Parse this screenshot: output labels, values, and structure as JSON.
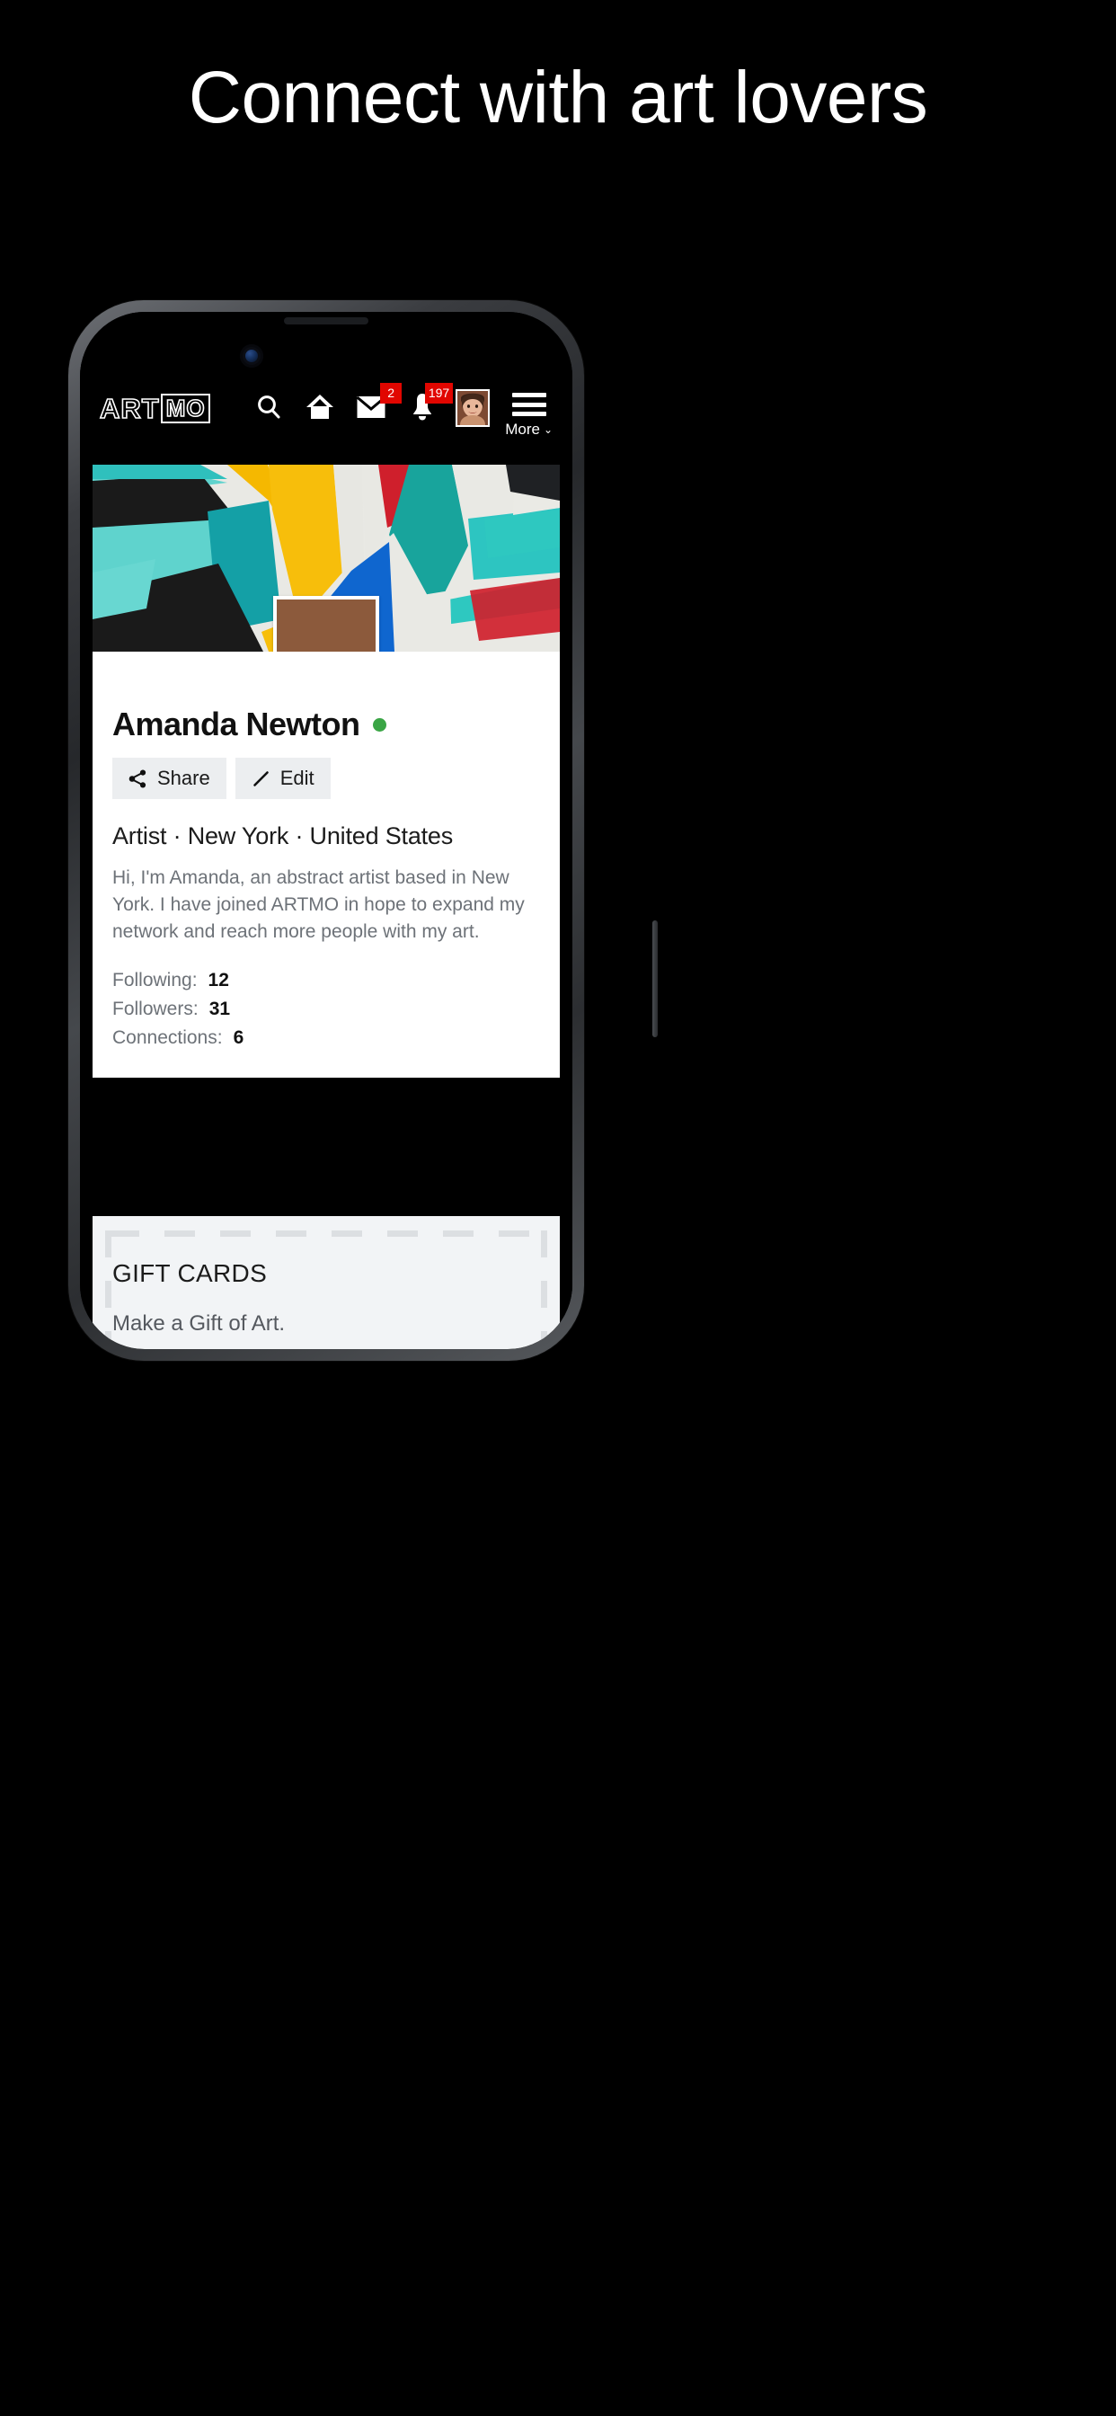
{
  "promo": {
    "headline": "Connect with art lovers"
  },
  "app": {
    "logo": {
      "part1": "ART",
      "part2": "MO"
    },
    "nav": {
      "search_label": "Search",
      "home_label": "Home",
      "messages_label": "Messages",
      "messages_badge": "2",
      "notifications_label": "Notifications",
      "notifications_badge": "197",
      "avatar_label": "Profile",
      "menu_label": "More",
      "menu_chevron": "⌄"
    }
  },
  "profile": {
    "name": "Amanda Newton",
    "online_status": "online",
    "share_label": "Share",
    "edit_label": "Edit",
    "meta": "Artist · New York · United States",
    "bio": "Hi, I'm Amanda, an abstract artist based in New York. I have joined ARTMO in hope to expand my network and reach more people with my art.",
    "stats": [
      {
        "label": "Following:",
        "value": "12"
      },
      {
        "label": "Followers:",
        "value": "31"
      },
      {
        "label": "Connections:",
        "value": "6"
      }
    ]
  },
  "gift_cards": {
    "title": "GIFT CARDS",
    "subtitle": "Make a Gift of Art."
  },
  "colors": {
    "badge_red": "#e10600",
    "online_green": "#3aa545",
    "page_bg": "#000000",
    "card_bg": "#ffffff",
    "gift_bg": "#f2f4f6"
  }
}
